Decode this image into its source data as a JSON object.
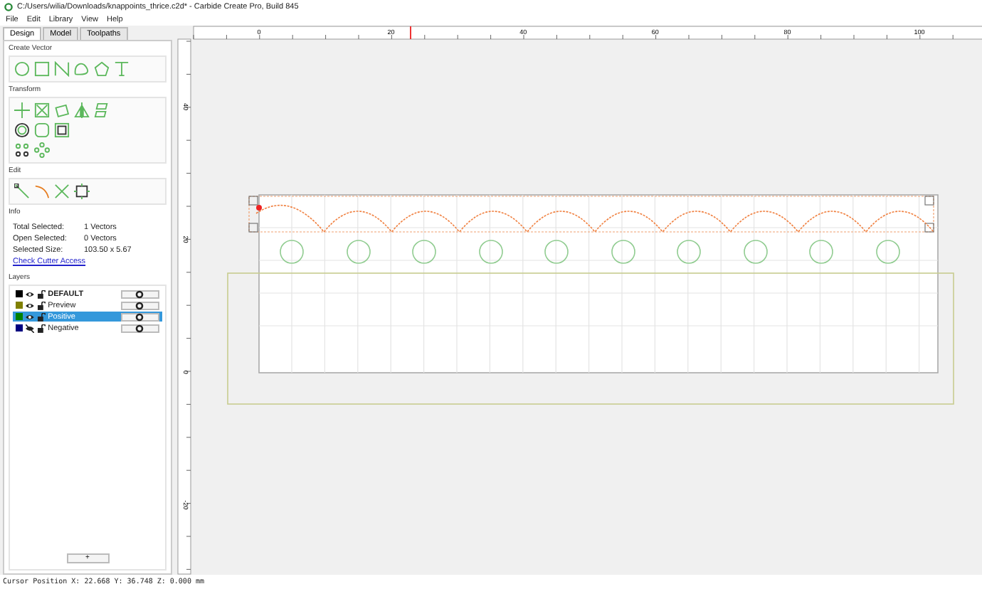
{
  "window": {
    "title": "C:/Users/wilia/Downloads/knappoints_thrice.c2d* - Carbide Create Pro, Build 845"
  },
  "menu": [
    "File",
    "Edit",
    "Library",
    "View",
    "Help"
  ],
  "tabs": [
    {
      "label": "Design",
      "selected": true
    },
    {
      "label": "Model",
      "selected": false
    },
    {
      "label": "Toolpaths",
      "selected": false
    }
  ],
  "sections": {
    "create_vector": "Create Vector",
    "transform": "Transform",
    "edit": "Edit",
    "info": "Info",
    "layers": "Layers"
  },
  "info": {
    "rows": [
      {
        "label": "Total Selected:",
        "value": "1 Vectors"
      },
      {
        "label": "Open Selected:",
        "value": "0 Vectors"
      },
      {
        "label": "Selected Size:",
        "value": "103.50 x 5.67"
      }
    ],
    "link": "Check Cutter Access"
  },
  "layers": [
    {
      "name": "DEFAULT",
      "kind": "default",
      "color": "#000000",
      "visible": true,
      "selected": false
    },
    {
      "name": "Preview",
      "kind": "normal",
      "color": "#808000",
      "visible": true,
      "selected": false
    },
    {
      "name": "Positive",
      "kind": "normal",
      "color": "#008000",
      "visible": true,
      "selected": true
    },
    {
      "name": "Negative",
      "kind": "normal",
      "color": "#000080",
      "visible": false,
      "selected": false
    }
  ],
  "add_layer_button": "+",
  "ruler": {
    "x_labels": [
      "0",
      "20",
      "40",
      "60",
      "80",
      "100"
    ],
    "y_labels": [
      "40",
      "20",
      "0",
      "-20"
    ]
  },
  "status_bar": "Cursor Position X: 22.668 Y: 36.748 Z: 0.000 mm"
}
